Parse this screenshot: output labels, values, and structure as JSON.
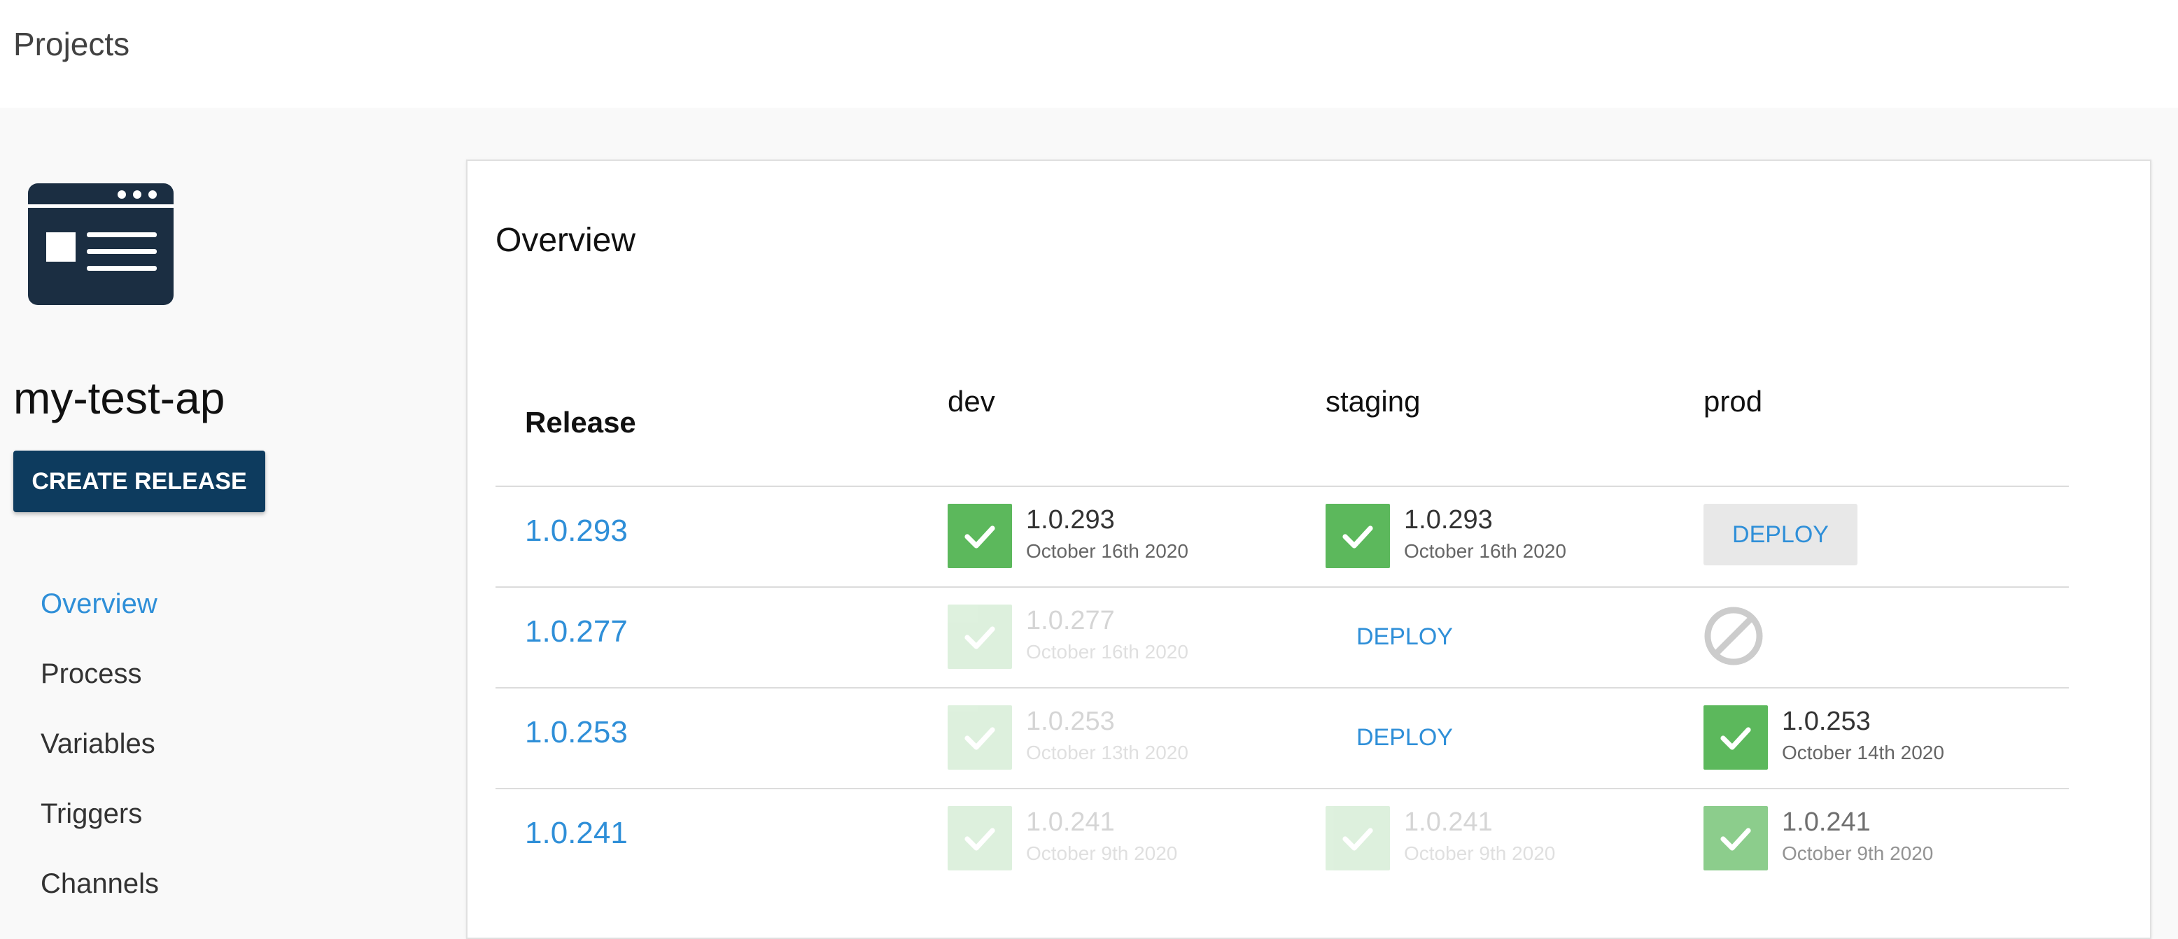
{
  "header": {
    "breadcrumb": "Projects"
  },
  "project": {
    "name": "my-test-ap",
    "create_release_label": "CREATE RELEASE",
    "logo_icon": "web-app-icon"
  },
  "nav": {
    "items": [
      {
        "label": "Overview",
        "active": true
      },
      {
        "label": "Process"
      },
      {
        "label": "Variables"
      },
      {
        "label": "Triggers"
      },
      {
        "label": "Channels"
      }
    ]
  },
  "overview": {
    "title": "Overview",
    "release_header": "Release",
    "environments": [
      "dev",
      "staging",
      "prod"
    ],
    "deploy_label": "DEPLOY",
    "rows": [
      {
        "release": "1.0.293",
        "dev": {
          "status": "success",
          "version": "1.0.293",
          "date": "October 16th 2020"
        },
        "staging": {
          "status": "success",
          "version": "1.0.293",
          "date": "October 16th 2020"
        },
        "prod": {
          "status": "deploy-button"
        }
      },
      {
        "release": "1.0.277",
        "dev": {
          "status": "success-previous",
          "version": "1.0.277",
          "date": "October 16th 2020"
        },
        "staging": {
          "status": "deploy-link"
        },
        "prod": {
          "status": "blocked"
        }
      },
      {
        "release": "1.0.253",
        "dev": {
          "status": "success-previous",
          "version": "1.0.253",
          "date": "October 13th 2020"
        },
        "staging": {
          "status": "deploy-link"
        },
        "prod": {
          "status": "success",
          "version": "1.0.253",
          "date": "October 14th 2020"
        }
      },
      {
        "release": "1.0.241",
        "dev": {
          "status": "success-previous",
          "version": "1.0.241",
          "date": "October 9th 2020"
        },
        "staging": {
          "status": "success-previous",
          "version": "1.0.241",
          "date": "October 9th 2020"
        },
        "prod": {
          "status": "success-partial",
          "version": "1.0.241",
          "date": "October 9th 2020"
        }
      }
    ]
  },
  "colors": {
    "accent": "#2f8fd8",
    "primary_button": "#0d3b5e",
    "success": "#5cb85c",
    "blocked": "#cccccc"
  }
}
